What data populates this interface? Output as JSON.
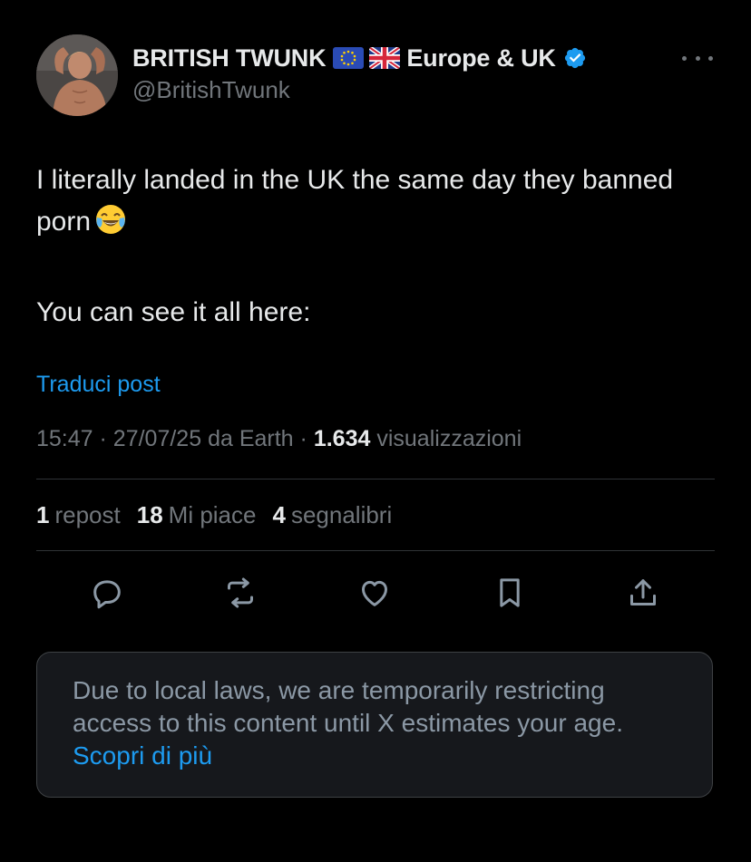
{
  "author": {
    "display_name": "BRITISH TWUNK",
    "flags": [
      "eu-flag-icon",
      "uk-flag-icon"
    ],
    "name_suffix": "Europe & UK",
    "verified": true,
    "handle": "@BritishTwunk"
  },
  "tweet": {
    "line1": "I literally landed in the UK the same day they banned porn",
    "emoji": "face-with-tears-of-joy",
    "line2": "You can see it all here:"
  },
  "translate_label": "Traduci post",
  "meta": {
    "time": "15:47",
    "separator": "·",
    "date": "27/07/25",
    "location": "da Earth",
    "views_count": "1.634",
    "views_label": "visualizzazioni"
  },
  "stats": {
    "reposts_count": "1",
    "reposts_label": "repost",
    "likes_count": "18",
    "likes_label": "Mi piace",
    "bookmarks_count": "4",
    "bookmarks_label": "segnalibri"
  },
  "actions": [
    "reply-icon",
    "repost-icon",
    "like-icon",
    "bookmark-icon",
    "share-icon"
  ],
  "notice": {
    "text": "Due to local laws, we are temporarily restricting access to this content until X estimates your age.",
    "link": "Scopri di più"
  },
  "colors": {
    "background": "#000000",
    "text": "#e7e9ea",
    "muted": "#71767b",
    "accent": "#1d9bf0",
    "divider": "#2f3336",
    "notice_bg": "#16181c"
  }
}
